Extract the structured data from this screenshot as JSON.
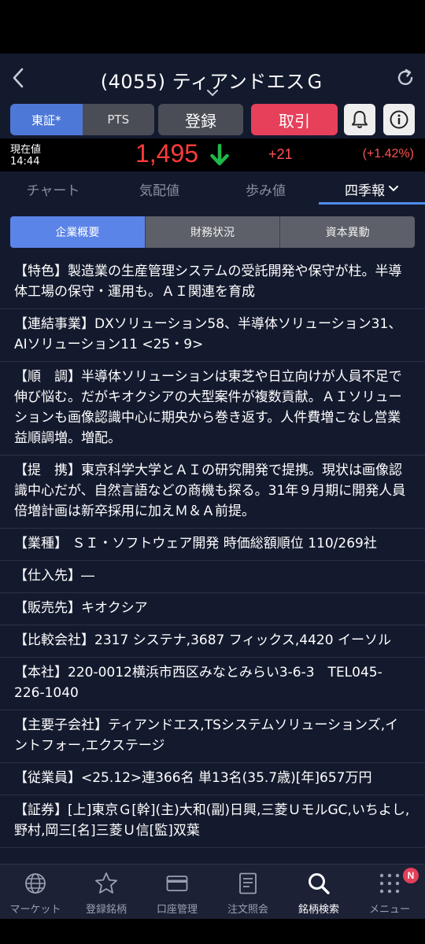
{
  "header": {
    "title": "(4055) ティアンドエスＧ"
  },
  "actions": {
    "exchange_tse": "東証*",
    "exchange_pts": "PTS",
    "register_label": "登録",
    "trade_label": "取引"
  },
  "price": {
    "label": "現在値",
    "time": "14:44",
    "value": "1,495",
    "change": "+21",
    "change_pct": "(+1.42%)"
  },
  "tabs": [
    {
      "label": "チャート"
    },
    {
      "label": "気配値"
    },
    {
      "label": "歩み値"
    },
    {
      "label": "四季報"
    }
  ],
  "subtabs": [
    {
      "label": "企業概要"
    },
    {
      "label": "財務状況"
    },
    {
      "label": "資本異動"
    }
  ],
  "sections": [
    {
      "text": "【特色】製造業の生産管理システムの受託開発や保守が柱。半導体工場の保守・運用も。ＡＩ関連を育成"
    },
    {
      "text": "【連結事業】DXソリューション58、半導体ソリューション31、AIソリューション11 <25・9>"
    },
    {
      "text": "【順　調】半導体ソリューションは東芝や日立向けが人員不足で伸び悩む。だがキオクシアの大型案件が複数貢献。ＡＩソリューションも画像認識中心に期央から巻き返す。人件費増こなし営業益順調増。増配。"
    },
    {
      "text": "【提　携】東京科学大学とＡＩの研究開発で提携。現状は画像認識中心だが、自然言語などの商機も探る。31年９月期に開発人員倍増計画は新卒採用に加えＭ＆Ａ前提。"
    },
    {
      "text": "【業種】 ＳＩ・ソフトウェア開発 時価総額順位 110/269社"
    },
    {
      "text": "【仕入先】―"
    },
    {
      "text": "【販売先】キオクシア"
    },
    {
      "text": "【比較会社】2317 システナ,3687 フィックス,4420 イーソル"
    },
    {
      "text": "【本社】220-0012横浜市西区みなとみらい3-6-3　TEL045-226-1040"
    },
    {
      "text": "【主要子会社】ティアンドエス,TSシステムソリューションズ,イントフォー,エクステージ"
    },
    {
      "text": "【従業員】<25.12>連366名 単13名(35.7歳)[年]657万円"
    },
    {
      "text": "【証券】[上]東京Ｇ[幹](主)大和(副)日興,三菱ＵモルGC,いちよし,野村,岡三[名]三菱Ｕ信[監]双葉"
    }
  ],
  "bottom_nav": [
    {
      "label": "マーケット",
      "icon": "globe-icon"
    },
    {
      "label": "登録銘柄",
      "icon": "star-icon"
    },
    {
      "label": "口座管理",
      "icon": "card-icon"
    },
    {
      "label": "注文照会",
      "icon": "document-icon"
    },
    {
      "label": "銘柄検索",
      "icon": "search-icon"
    },
    {
      "label": "メニュー",
      "icon": "grid-menu-icon",
      "badge": "N"
    }
  ],
  "colors": {
    "background": "#141a2e",
    "price_up": "#ff3b3b",
    "arrow": "#1fb84a",
    "trade_button": "#e6405a",
    "accent_blue": "#4e78d8"
  }
}
